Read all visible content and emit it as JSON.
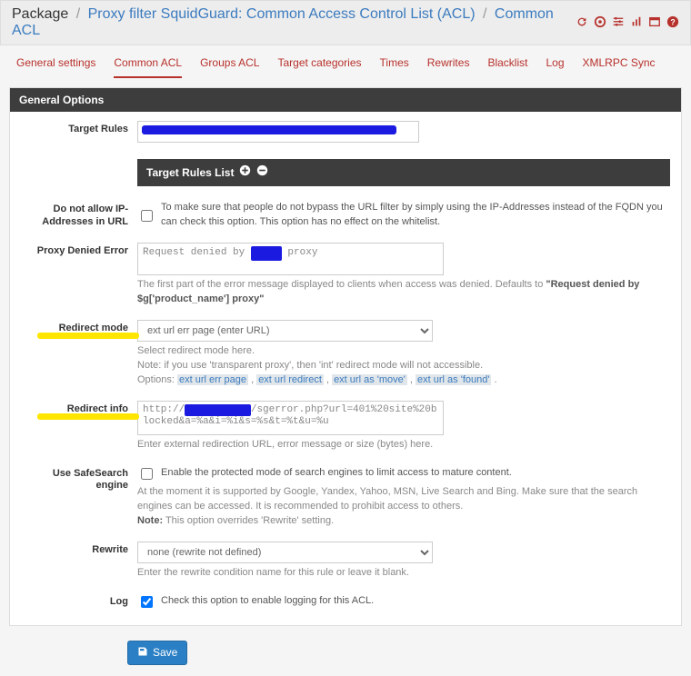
{
  "breadcrumb": {
    "root": "Package",
    "mid": "Proxy filter SquidGuard: Common Access Control List (ACL)",
    "leaf": "Common ACL"
  },
  "tabs": [
    {
      "label": "General settings"
    },
    {
      "label": "Common ACL",
      "active": true
    },
    {
      "label": "Groups ACL"
    },
    {
      "label": "Target categories"
    },
    {
      "label": "Times"
    },
    {
      "label": "Rewrites"
    },
    {
      "label": "Blacklist"
    },
    {
      "label": "Log"
    },
    {
      "label": "XMLRPC Sync"
    }
  ],
  "panel": {
    "title": "General Options"
  },
  "target_rules": {
    "label": "Target Rules",
    "list_header": "Target Rules List"
  },
  "no_ip": {
    "label": "Do not allow IP-Addresses in URL",
    "text": "To make sure that people do not bypass the URL filter by simply using the IP-Addresses instead of the FQDN you can check this option. This option has no effect on the whitelist.",
    "checked": false
  },
  "proxy_denied": {
    "label": "Proxy Denied Error",
    "value_pre": "Request denied by ",
    "value_post": " proxy",
    "help_pre": "The first part of the error message displayed to clients when access was denied. Defaults to ",
    "help_strong": "\"Request denied by $g['product_name'] proxy\""
  },
  "redirect_mode": {
    "label": "Redirect mode",
    "selected": "ext url err page (enter URL)",
    "help1": "Select redirect mode here.",
    "help2": "Note: if you use 'transparent proxy', then 'int' redirect mode will not accessible.",
    "opt_prefix": "Options:",
    "opts": [
      "ext url err page",
      "ext url redirect",
      "ext url as 'move'",
      "ext url as 'found'"
    ]
  },
  "redirect_info": {
    "label": "Redirect info",
    "val_pre": "http://",
    "val_post": "/sgerror.php?url=401%20site%20blocked&a=%a&i=%i&s=%s&t=%t&u=%u",
    "help": "Enter external redirection URL, error message or size (bytes) here."
  },
  "safesearch": {
    "label": "Use SafeSearch engine",
    "text": "Enable the protected mode of search engines to limit access to mature content.",
    "help1": "At the moment it is supported by Google, Yandex, Yahoo, MSN, Live Search and Bing. Make sure that the search engines can be accessed. It is recommended to prohibit access to others.",
    "help2_label": "Note:",
    "help2_rest": " This option overrides 'Rewrite' setting.",
    "checked": false
  },
  "rewrite": {
    "label": "Rewrite",
    "selected": "none (rewrite not defined)",
    "help": "Enter the rewrite condition name for this rule or leave it blank."
  },
  "log": {
    "label": "Log",
    "text": "Check this option to enable logging for this ACL.",
    "checked": true
  },
  "save": {
    "label": "Save"
  }
}
